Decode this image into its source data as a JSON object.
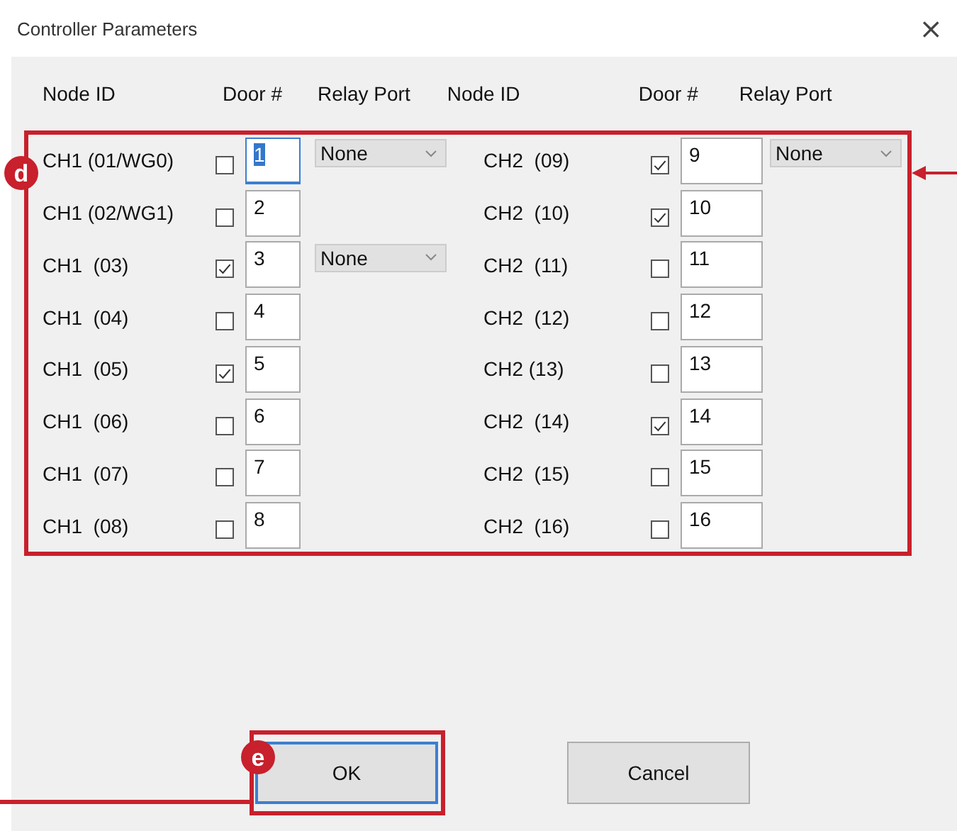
{
  "window": {
    "title": "Controller Parameters",
    "close": "×"
  },
  "columns": [
    {
      "node": "Node ID",
      "door": "Door #",
      "relay": "Relay Port"
    },
    {
      "node": "Node ID",
      "door": "Door #",
      "relay": "Relay Port"
    }
  ],
  "groups": [
    {
      "rows": [
        {
          "node": "CH1 (01/WG0)",
          "checked": false,
          "door": "1",
          "focused": true,
          "relay": "None"
        },
        {
          "node": "CH1 (02/WG1)",
          "checked": false,
          "door": "2",
          "focused": false
        },
        {
          "node": "CH1  (03)",
          "checked": true,
          "door": "3",
          "focused": false,
          "relay": "None"
        },
        {
          "node": "CH1  (04)",
          "checked": false,
          "door": "4",
          "focused": false
        },
        {
          "node": "CH1  (05)",
          "checked": true,
          "door": "5",
          "focused": false
        },
        {
          "node": "CH1  (06)",
          "checked": false,
          "door": "6",
          "focused": false
        },
        {
          "node": "CH1  (07)",
          "checked": false,
          "door": "7",
          "focused": false
        },
        {
          "node": "CH1  (08)",
          "checked": false,
          "door": "8",
          "focused": false
        }
      ]
    },
    {
      "rows": [
        {
          "node": "CH2  (09)",
          "checked": true,
          "door": "9",
          "focused": false,
          "relay": "None"
        },
        {
          "node": "CH2  (10)",
          "checked": true,
          "door": "10",
          "focused": false
        },
        {
          "node": "CH2  (11)",
          "checked": false,
          "door": "11",
          "focused": false
        },
        {
          "node": "CH2  (12)",
          "checked": false,
          "door": "12",
          "focused": false
        },
        {
          "node": "CH2 (13)",
          "checked": false,
          "door": "13",
          "focused": false
        },
        {
          "node": "CH2  (14)",
          "checked": true,
          "door": "14",
          "focused": false
        },
        {
          "node": "CH2  (15)",
          "checked": false,
          "door": "15",
          "focused": false
        },
        {
          "node": "CH2  (16)",
          "checked": false,
          "door": "16",
          "focused": false
        }
      ]
    }
  ],
  "callouts": [
    {
      "label": "d"
    },
    {
      "label": "e"
    }
  ],
  "buttons": [
    {
      "label": "OK",
      "default": true
    },
    {
      "label": "Cancel",
      "default": false
    }
  ]
}
